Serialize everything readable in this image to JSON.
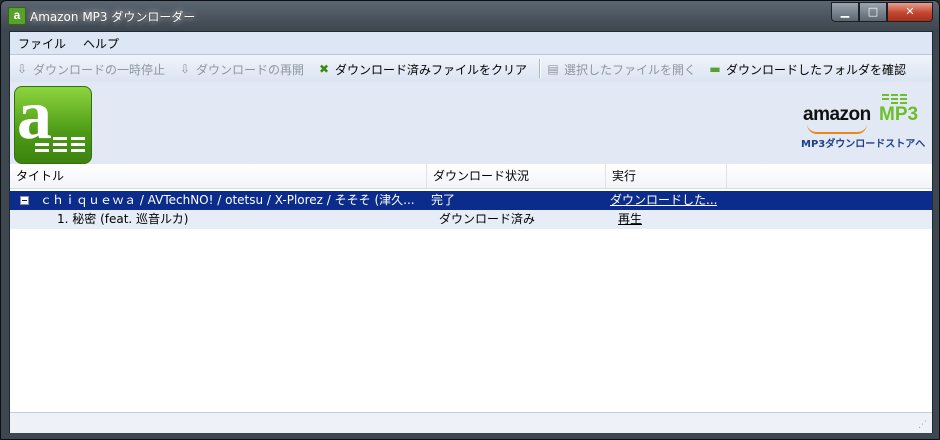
{
  "window": {
    "title": "Amazon MP3 ダウンローダー",
    "app_icon_glyph": "a"
  },
  "window_controls": {
    "minimize": "▁",
    "maximize": "□",
    "close": "✕"
  },
  "menu": {
    "items": [
      "ファイル",
      "ヘルプ"
    ]
  },
  "toolbar": {
    "pause": {
      "label": "ダウンロードの一時停止",
      "icon": "pause-arrow-icon",
      "glyph": "⇩",
      "enabled": false
    },
    "resume": {
      "label": "ダウンロードの再開",
      "icon": "resume-arrow-icon",
      "glyph": "⇩",
      "enabled": false
    },
    "clear": {
      "label": "ダウンロード済みファイルをクリア",
      "icon": "clear-downloads-icon",
      "glyph": "✖",
      "enabled": true
    },
    "open_selected": {
      "label": "選択したファイルを開く",
      "icon": "open-file-icon",
      "glyph": "▤",
      "enabled": false
    },
    "open_folder": {
      "label": "ダウンロードしたフォルダを確認",
      "icon": "folder-icon",
      "glyph": "▬",
      "enabled": true
    }
  },
  "banner": {
    "logo_glyph": "a",
    "amazon_word": "amazon",
    "mp3_word": "MP3",
    "store_link": "MP3ダウンロードストアへ"
  },
  "table": {
    "columns": [
      "タイトル",
      "ダウンロード状況",
      "実行"
    ],
    "rows": [
      {
        "type": "group",
        "expanded": true,
        "title": "ｃｈｉｑｕｅｗａ / AVTechNO! / otetsu / X-Plorez / そそそ (津久...",
        "status": "完了",
        "action": "ダウンロードした..."
      },
      {
        "type": "track",
        "title": "1. 秘密 (feat. 巡音ルカ)",
        "status": "ダウンロード済み",
        "action": "再生"
      }
    ]
  },
  "colors": {
    "selection": "#0b2c8a",
    "brand_green": "#6bbf2a",
    "amazon_orange": "#e88a1a"
  }
}
